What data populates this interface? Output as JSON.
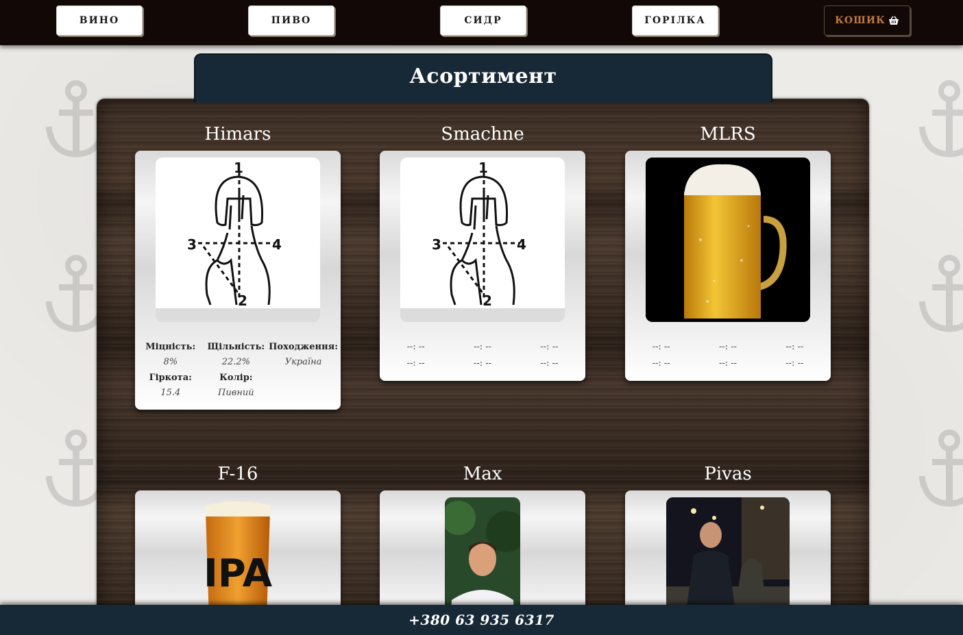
{
  "nav": {
    "items": [
      {
        "label": "ВИНО"
      },
      {
        "label": "ПИВО"
      },
      {
        "label": "СИДР"
      },
      {
        "label": "ГОРІЛКА"
      }
    ],
    "cart_label": "КОШИК",
    "cart_icon": "basket-icon"
  },
  "page_title": "Асортимент",
  "products": [
    {
      "name": "Himars",
      "image": "stop-gesture-illustration",
      "specs": [
        {
          "label": "Міцність:",
          "value": "8%"
        },
        {
          "label": "Щільність:",
          "value": "22.2%"
        },
        {
          "label": "Походження:",
          "value": "Україна"
        },
        {
          "label": "Гіркота:",
          "value": "15.4"
        },
        {
          "label": "Колір:",
          "value": "Пивний"
        }
      ]
    },
    {
      "name": "Smachne",
      "image": "stop-gesture-illustration",
      "placeholder": "--: --"
    },
    {
      "name": "MLRS",
      "image": "beer-mug-photo",
      "placeholder": "--: --"
    },
    {
      "name": "F-16",
      "image": "ipa-glass-photo"
    },
    {
      "name": "Max",
      "image": "man-portrait-photo"
    },
    {
      "name": "Pivas",
      "image": "night-street-photo"
    }
  ],
  "footer": {
    "phone": "+380 63 935 6317"
  },
  "colors": {
    "topbar": "#120805",
    "title_tab": "#172936",
    "footer": "#172936",
    "cart_text": "#c07a3e"
  }
}
